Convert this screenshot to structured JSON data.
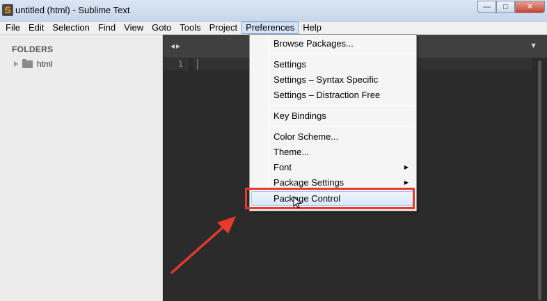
{
  "window": {
    "title": "untitled (html) - Sublime Text",
    "icon": "sublime-text-app-icon",
    "controls": {
      "minimize": "—",
      "maximize": "□",
      "close": "✕"
    }
  },
  "menubar": {
    "items": [
      "File",
      "Edit",
      "Selection",
      "Find",
      "View",
      "Goto",
      "Tools",
      "Project",
      "Preferences",
      "Help"
    ],
    "active": "Preferences"
  },
  "sidebar": {
    "header": "FOLDERS",
    "folders": [
      {
        "name": "html",
        "expanded": false
      }
    ]
  },
  "editor": {
    "line_number": "1",
    "nav_arrows": "◂▸",
    "tab_dropdown": "▼"
  },
  "preferences_menu": {
    "items": [
      {
        "label": "Browse Packages...",
        "submenu": false
      },
      {
        "label": "Settings",
        "submenu": false
      },
      {
        "label": "Settings – Syntax Specific",
        "submenu": false
      },
      {
        "label": "Settings – Distraction Free",
        "submenu": false
      },
      {
        "label": "Key Bindings",
        "submenu": false
      },
      {
        "label": "Color Scheme...",
        "submenu": false
      },
      {
        "label": "Theme...",
        "submenu": false
      },
      {
        "label": "Font",
        "submenu": true
      },
      {
        "label": "Package Settings",
        "submenu": true
      },
      {
        "label": "Package Control",
        "submenu": false,
        "highlighted": true
      }
    ],
    "submenu_glyph": "▶"
  },
  "annotation": {
    "highlight_color": "#e8392b",
    "arrow_color": "#e8392b"
  }
}
